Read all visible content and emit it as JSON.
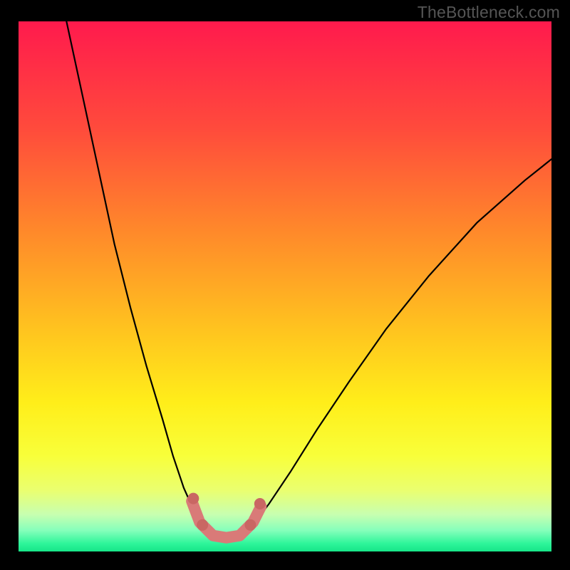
{
  "watermark": "TheBottleneck.com",
  "chart_data": {
    "type": "line",
    "title": "",
    "xlabel": "",
    "ylabel": "",
    "xlim": [
      0,
      100
    ],
    "ylim": [
      0,
      100
    ],
    "grid": false,
    "legend": false,
    "background_gradient_stops": [
      {
        "offset": 0.0,
        "color": "#ff1a4d"
      },
      {
        "offset": 0.2,
        "color": "#ff4a3c"
      },
      {
        "offset": 0.4,
        "color": "#ff8a2a"
      },
      {
        "offset": 0.58,
        "color": "#ffc31f"
      },
      {
        "offset": 0.72,
        "color": "#ffee1a"
      },
      {
        "offset": 0.82,
        "color": "#f8ff3a"
      },
      {
        "offset": 0.885,
        "color": "#eaff70"
      },
      {
        "offset": 0.93,
        "color": "#c8ffb0"
      },
      {
        "offset": 0.96,
        "color": "#86ffbb"
      },
      {
        "offset": 0.985,
        "color": "#2ef59a"
      },
      {
        "offset": 1.0,
        "color": "#17e588"
      }
    ],
    "series": [
      {
        "name": "left-branch",
        "stroke": "#000000",
        "stroke_width": 2.2,
        "points": [
          {
            "x": 9.0,
            "y": 100.0
          },
          {
            "x": 12.0,
            "y": 86.0
          },
          {
            "x": 15.0,
            "y": 72.0
          },
          {
            "x": 18.0,
            "y": 58.0
          },
          {
            "x": 21.0,
            "y": 46.0
          },
          {
            "x": 24.0,
            "y": 35.0
          },
          {
            "x": 27.0,
            "y": 25.0
          },
          {
            "x": 29.0,
            "y": 18.0
          },
          {
            "x": 31.0,
            "y": 12.0
          },
          {
            "x": 33.0,
            "y": 7.5
          },
          {
            "x": 35.0,
            "y": 4.5
          },
          {
            "x": 36.5,
            "y": 3.0
          }
        ]
      },
      {
        "name": "right-branch",
        "stroke": "#000000",
        "stroke_width": 2.2,
        "points": [
          {
            "x": 42.0,
            "y": 3.0
          },
          {
            "x": 44.0,
            "y": 5.0
          },
          {
            "x": 47.0,
            "y": 9.0
          },
          {
            "x": 51.0,
            "y": 15.0
          },
          {
            "x": 56.0,
            "y": 23.0
          },
          {
            "x": 62.0,
            "y": 32.0
          },
          {
            "x": 69.0,
            "y": 42.0
          },
          {
            "x": 77.0,
            "y": 52.0
          },
          {
            "x": 86.0,
            "y": 62.0
          },
          {
            "x": 95.0,
            "y": 70.0
          },
          {
            "x": 100.0,
            "y": 74.0
          }
        ]
      }
    ],
    "markers": [
      {
        "name": "valley-segment",
        "type": "thick-path",
        "stroke": "#d97a78",
        "stroke_width": 16,
        "points": [
          {
            "x": 32.5,
            "y": 9.5
          },
          {
            "x": 34.0,
            "y": 5.5
          },
          {
            "x": 36.5,
            "y": 3.0
          },
          {
            "x": 39.0,
            "y": 2.6
          },
          {
            "x": 41.5,
            "y": 3.0
          },
          {
            "x": 44.0,
            "y": 5.5
          },
          {
            "x": 45.5,
            "y": 8.5
          }
        ]
      },
      {
        "name": "dot-left-upper",
        "type": "dot",
        "fill": "#c96763",
        "r": 8,
        "x": 32.8,
        "y": 10.0
      },
      {
        "name": "dot-left-lower",
        "type": "dot",
        "fill": "#c96763",
        "r": 8,
        "x": 34.5,
        "y": 5.0
      },
      {
        "name": "dot-right-lower",
        "type": "dot",
        "fill": "#c96763",
        "r": 8,
        "x": 43.5,
        "y": 5.0
      },
      {
        "name": "dot-right-upper",
        "type": "dot",
        "fill": "#c96763",
        "r": 8,
        "x": 45.3,
        "y": 9.0
      }
    ]
  }
}
